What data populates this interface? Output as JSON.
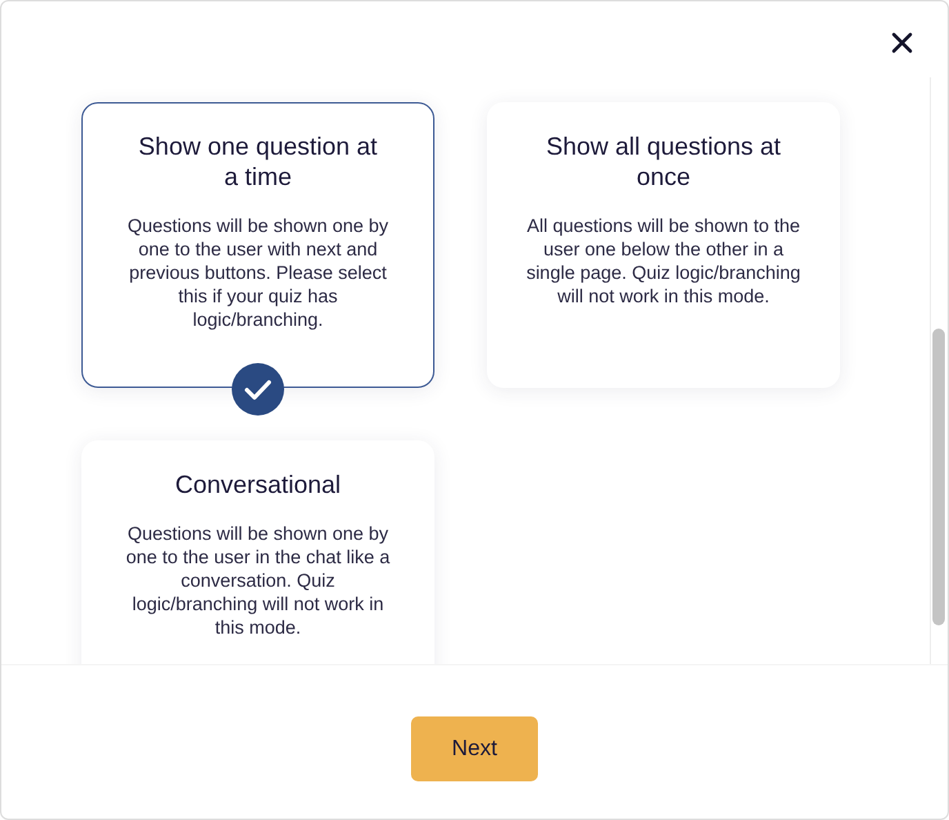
{
  "options": [
    {
      "title": "Show one question at a time",
      "description": "Questions will be shown one by one to the user with next and previous buttons. Please select this if your quiz has logic/branching.",
      "selected": true
    },
    {
      "title": "Show all questions at once",
      "description": "All questions will be shown to the user one below the other in a single page. Quiz logic/branching will not work in this mode.",
      "selected": false
    },
    {
      "title": "Conversational",
      "description": "Questions will be shown one by one to the user in the chat like a conversation. Quiz logic/branching will not work in this mode.",
      "selected": false
    }
  ],
  "next_button": "Next"
}
